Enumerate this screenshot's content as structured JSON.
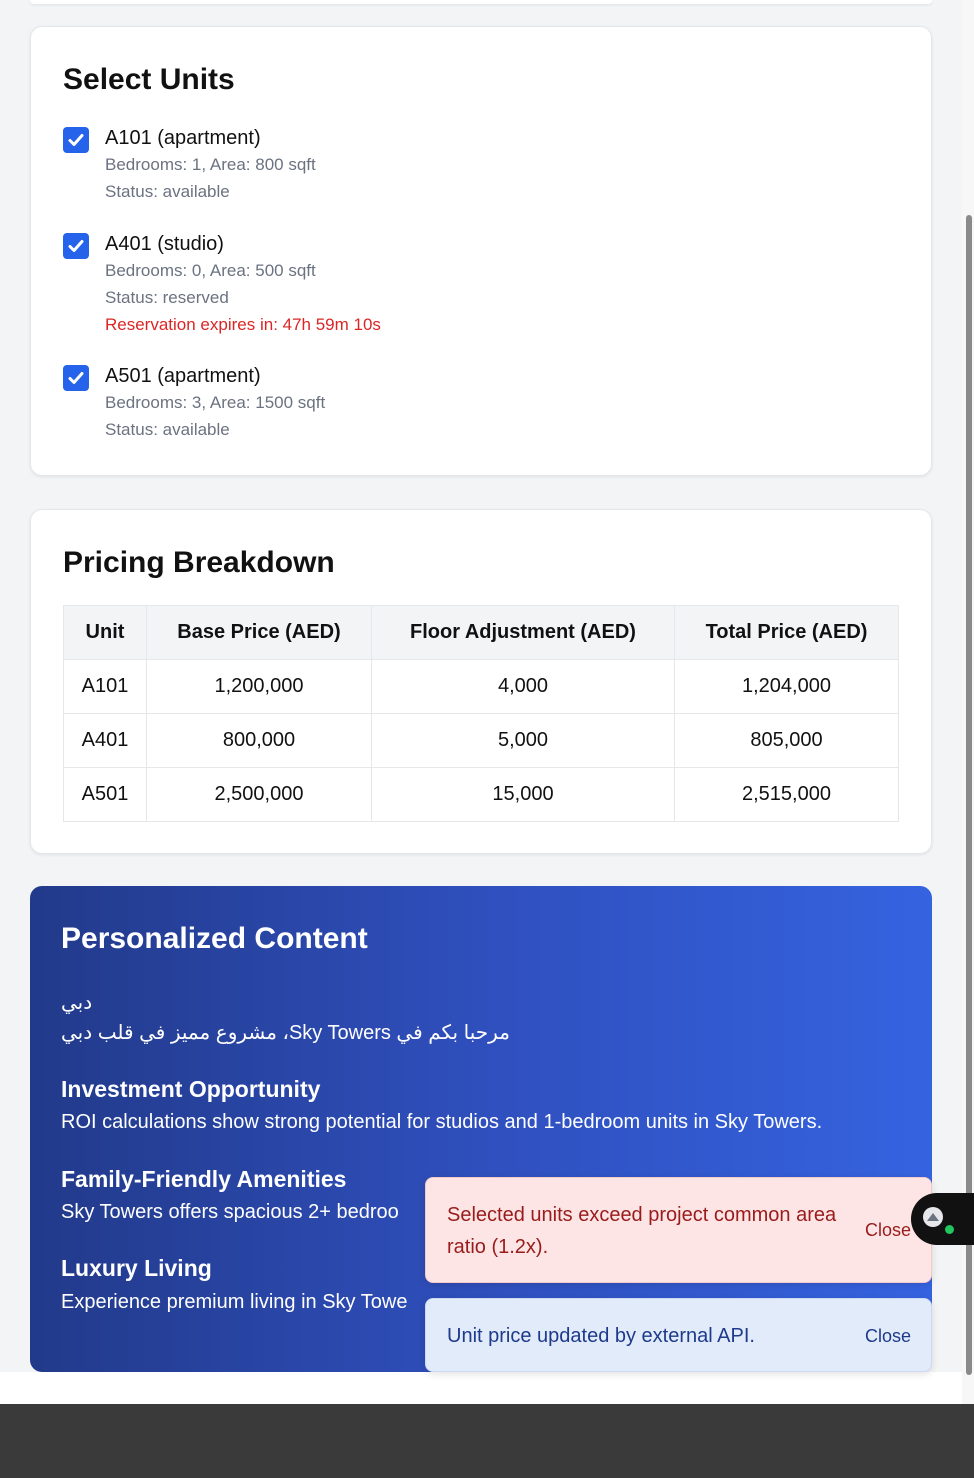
{
  "units_card": {
    "title": "Select Units",
    "units": [
      {
        "title": "A101 (apartment)",
        "details": "Bedrooms: 1, Area: 800 sqft",
        "status": "Status: available",
        "checked": true
      },
      {
        "title": "A401 (studio)",
        "details": "Bedrooms: 0, Area: 500 sqft",
        "status": "Status: reserved",
        "warning": "Reservation expires in: 47h 59m 10s",
        "checked": true
      },
      {
        "title": "A501 (apartment)",
        "details": "Bedrooms: 3, Area: 1500 sqft",
        "status": "Status: available",
        "checked": true
      }
    ]
  },
  "pricing": {
    "title": "Pricing Breakdown",
    "headers": [
      "Unit",
      "Base Price (AED)",
      "Floor Adjustment (AED)",
      "Total Price (AED)"
    ],
    "rows": [
      [
        "A101",
        "1,200,000",
        "4,000",
        "1,204,000"
      ],
      [
        "A401",
        "800,000",
        "5,000",
        "805,000"
      ],
      [
        "A501",
        "2,500,000",
        "15,000",
        "2,515,000"
      ]
    ]
  },
  "personalized": {
    "title": "Personalized Content",
    "arabic_line1": "دبي",
    "arabic_line2": "مرحبا بكم في Sky Towers، مشروع مميز في قلب دبي",
    "sections": [
      {
        "heading": "Investment Opportunity",
        "text": "ROI calculations show strong potential for studios and 1-bedroom units in Sky Towers."
      },
      {
        "heading": "Family-Friendly Amenities",
        "text": "Sky Towers offers spacious 2+ bedroo"
      },
      {
        "heading": "Luxury Living",
        "text": "Experience premium living in Sky Towe"
      }
    ]
  },
  "toasts": [
    {
      "type": "error",
      "message": "Selected units exceed project common area ratio (1.2x).",
      "close_label": "Close"
    },
    {
      "type": "info",
      "message": "Unit price updated by external API.",
      "close_label": "Close"
    }
  ],
  "colors": {
    "accent": "#2563eb",
    "warning": "#dc2626",
    "error_bg": "#fde5e5",
    "info_bg": "#e2ebfa"
  }
}
